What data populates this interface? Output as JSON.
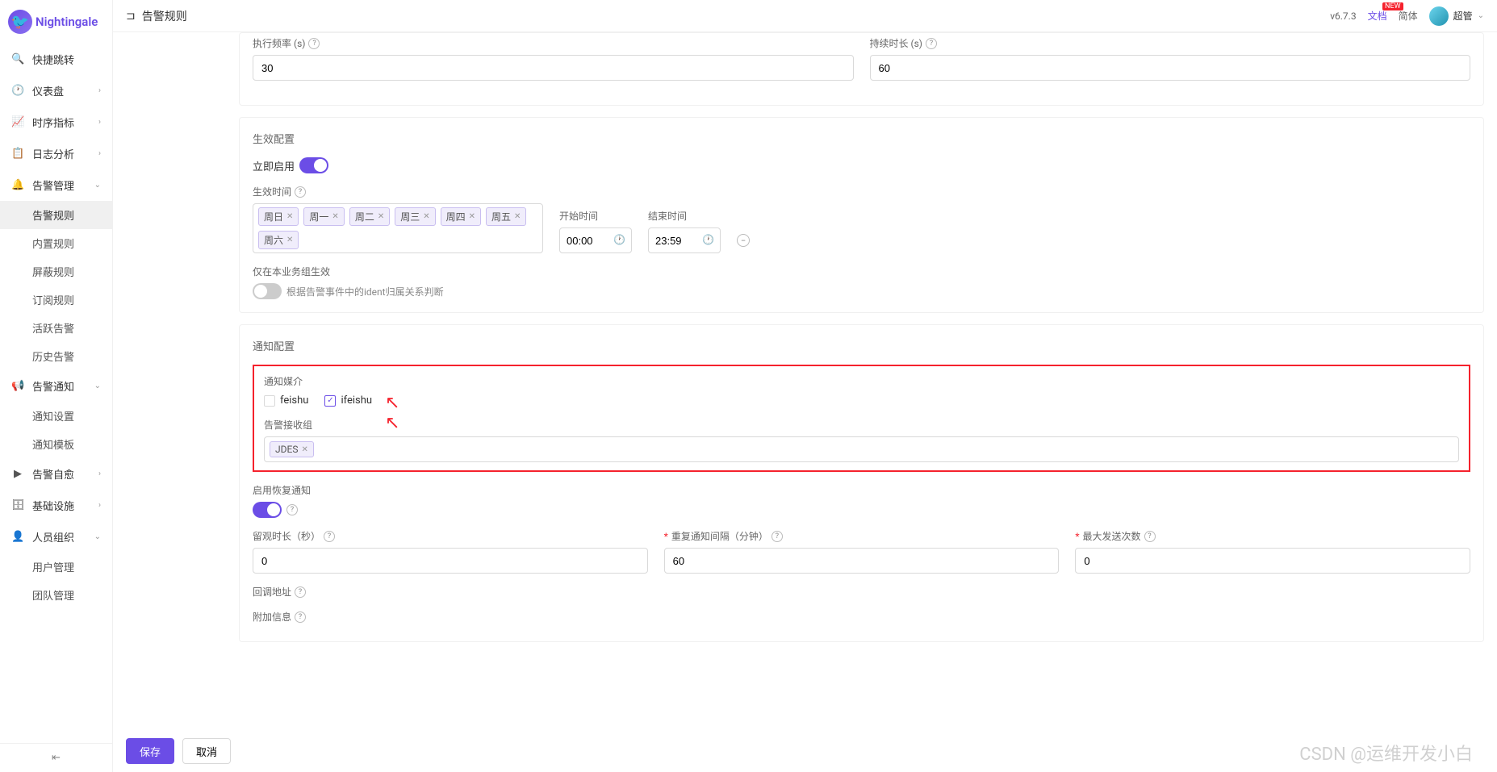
{
  "logo": "Nightingale",
  "header": {
    "back_icon": "⊐",
    "title": "告警规则",
    "version": "v6.7.3",
    "doc": "文档",
    "badge_new": "NEW",
    "lang": "简体",
    "user": "超管"
  },
  "sidebar": {
    "items": [
      {
        "icon": "🔍",
        "label": "快捷跳转",
        "chev": ""
      },
      {
        "icon": "🕐",
        "label": "仪表盘",
        "chev": "›"
      },
      {
        "icon": "📈",
        "label": "时序指标",
        "chev": "›"
      },
      {
        "icon": "📋",
        "label": "日志分析",
        "chev": "›"
      },
      {
        "icon": "🔔",
        "label": "告警管理",
        "chev": "⌄"
      },
      {
        "icon": "📢",
        "label": "告警通知",
        "chev": "⌄"
      },
      {
        "icon": "▶",
        "label": "告警自愈",
        "chev": "›"
      },
      {
        "icon": "🗄",
        "label": "基础设施",
        "chev": "›"
      },
      {
        "icon": "👤",
        "label": "人员组织",
        "chev": "⌄"
      }
    ],
    "alert_mgmt_subs": [
      "告警规则",
      "内置规则",
      "屏蔽规则",
      "订阅规则",
      "活跃告警",
      "历史告警"
    ],
    "alert_notify_subs": [
      "通知设置",
      "通知模板"
    ],
    "person_subs": [
      "用户管理",
      "团队管理"
    ]
  },
  "exec": {
    "freq_label": "执行频率 (s)",
    "freq_value": "30",
    "dur_label": "持续时长 (s)",
    "dur_value": "60"
  },
  "effect": {
    "section": "生效配置",
    "enable_label": "立即启用",
    "time_label": "生效时间",
    "days": [
      "周日",
      "周一",
      "周二",
      "周三",
      "周四",
      "周五",
      "周六"
    ],
    "start_label": "开始时间",
    "start_value": "00:00",
    "end_label": "结束时间",
    "end_value": "23:59",
    "scope_label": "仅在本业务组生效",
    "scope_hint": "根据告警事件中的ident归属关系判断"
  },
  "notify": {
    "section": "通知配置",
    "media_label": "通知媒介",
    "media_options": [
      {
        "label": "feishu",
        "checked": false
      },
      {
        "label": "ifeishu",
        "checked": true
      }
    ],
    "recv_label": "告警接收组",
    "recv_tags": [
      "JDES"
    ],
    "recover_label": "启用恢复通知",
    "mute_label": "留观时长（秒）",
    "mute_value": "0",
    "repeat_label": "重复通知间隔（分钟）",
    "repeat_value": "60",
    "max_label": "最大发送次数",
    "max_value": "0",
    "callback_label": "回调地址",
    "extra_label": "附加信息"
  },
  "footer": {
    "save": "保存",
    "cancel": "取消"
  },
  "watermark": "CSDN @运维开发小白"
}
